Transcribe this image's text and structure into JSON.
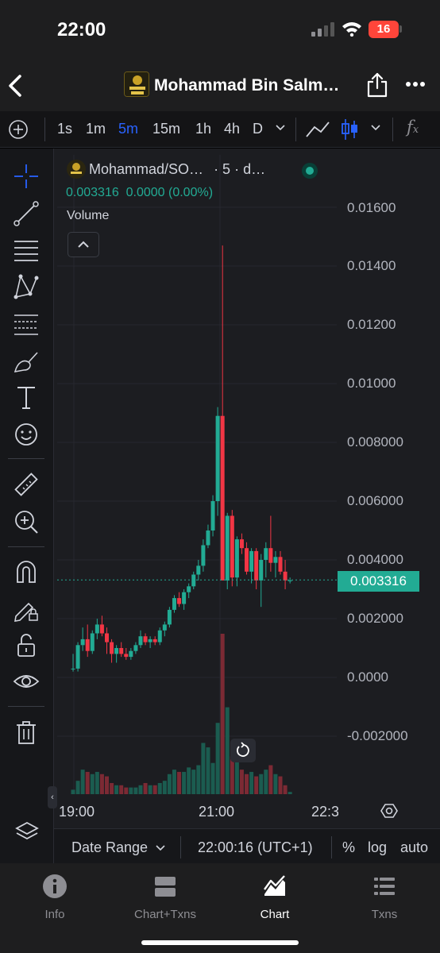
{
  "status_bar": {
    "time": "22:00",
    "battery": "16"
  },
  "header": {
    "title": "Mohammad Bin Salm…"
  },
  "timeframes": [
    "1s",
    "1m",
    "5m",
    "15m",
    "1h",
    "4h",
    "D"
  ],
  "active_timeframe": "5m",
  "legend": {
    "symbol": "Mohammad/SO…",
    "interval": "· 5 · d…",
    "price_line": "0.003316  0.0000 (0.00%)",
    "volume_label": "Volume"
  },
  "current_price_tag": "0.003316",
  "bottom_bar": {
    "date_range": "Date Range",
    "clock": "22:00:16 (UTC+1)",
    "percent": "%",
    "log": "log",
    "auto": "auto"
  },
  "tabs": [
    {
      "label": "Info",
      "icon": "info-icon"
    },
    {
      "label": "Chart+Txns",
      "icon": "split-view-icon"
    },
    {
      "label": "Chart",
      "icon": "chart-icon"
    },
    {
      "label": "Txns",
      "icon": "list-icon"
    }
  ],
  "active_tab": "Chart",
  "colors": {
    "up": "#22ab94",
    "down": "#f23645",
    "accent": "#2962ff",
    "background": "#1c1d21"
  },
  "chart_data": {
    "type": "candlestick",
    "y_axis": {
      "ticks": [
        "0.01600",
        "0.01400",
        "0.01200",
        "0.01000",
        "0.008000",
        "0.006000",
        "0.004000",
        "0.002000",
        "0.0000",
        "-0.002000"
      ],
      "range": [
        -0.0036,
        0.0177
      ]
    },
    "x_axis": {
      "ticks": [
        "19:00",
        "21:00",
        "22:3"
      ]
    },
    "current_price": 0.003316,
    "candles": [
      [
        0.0003,
        0.0008,
        0.0002,
        0.0003
      ],
      [
        0.0003,
        0.0012,
        0.0002,
        0.0011
      ],
      [
        0.0011,
        0.0017,
        0.0009,
        0.0013
      ],
      [
        0.0013,
        0.0018,
        0.0007,
        0.0009
      ],
      [
        0.0009,
        0.0016,
        0.0008,
        0.0015
      ],
      [
        0.0015,
        0.002,
        0.0013,
        0.0018
      ],
      [
        0.0018,
        0.0021,
        0.0014,
        0.0015
      ],
      [
        0.0015,
        0.0017,
        0.0008,
        0.0012
      ],
      [
        0.0012,
        0.0013,
        0.0005,
        0.0008
      ],
      [
        0.0008,
        0.0011,
        0.0005,
        0.001
      ],
      [
        0.001,
        0.0012,
        0.0007,
        0.0008
      ],
      [
        0.0008,
        0.001,
        0.0006,
        0.0007
      ],
      [
        0.0007,
        0.001,
        0.0006,
        0.0009
      ],
      [
        0.0009,
        0.0012,
        0.0008,
        0.0011
      ],
      [
        0.0011,
        0.0016,
        0.001,
        0.0014
      ],
      [
        0.0014,
        0.0015,
        0.0011,
        0.0012
      ],
      [
        0.0012,
        0.0014,
        0.001,
        0.0013
      ],
      [
        0.0013,
        0.0014,
        0.0011,
        0.0012
      ],
      [
        0.0012,
        0.0017,
        0.0011,
        0.0016
      ],
      [
        0.0016,
        0.0019,
        0.0014,
        0.0018
      ],
      [
        0.0018,
        0.0024,
        0.0017,
        0.0023
      ],
      [
        0.0023,
        0.0028,
        0.0022,
        0.0027
      ],
      [
        0.0027,
        0.0029,
        0.0024,
        0.0025
      ],
      [
        0.0025,
        0.003,
        0.0023,
        0.0029
      ],
      [
        0.0029,
        0.0032,
        0.0027,
        0.0031
      ],
      [
        0.0031,
        0.0036,
        0.003,
        0.0035
      ],
      [
        0.0035,
        0.004,
        0.0033,
        0.0038
      ],
      [
        0.0038,
        0.0047,
        0.0036,
        0.0045
      ],
      [
        0.0045,
        0.0052,
        0.0044,
        0.005
      ],
      [
        0.005,
        0.0062,
        0.0048,
        0.006
      ],
      [
        0.006,
        0.0092,
        0.0055,
        0.0089
      ],
      [
        0.0089,
        0.0147,
        0.0034,
        0.0033
      ],
      [
        0.0033,
        0.0056,
        0.003,
        0.0055
      ],
      [
        0.0055,
        0.0057,
        0.0031,
        0.0034
      ],
      [
        0.0034,
        0.0048,
        0.0031,
        0.0047
      ],
      [
        0.0047,
        0.0049,
        0.0042,
        0.0044
      ],
      [
        0.0044,
        0.0046,
        0.0035,
        0.0036
      ],
      [
        0.0036,
        0.0044,
        0.0032,
        0.0043
      ],
      [
        0.0043,
        0.0044,
        0.003,
        0.0033
      ],
      [
        0.0033,
        0.0042,
        0.0024,
        0.004
      ],
      [
        0.004,
        0.0046,
        0.0034,
        0.0044
      ],
      [
        0.0044,
        0.0055,
        0.0036,
        0.0039
      ],
      [
        0.0039,
        0.0043,
        0.0034,
        0.0041
      ],
      [
        0.0041,
        0.0043,
        0.0035,
        0.0036
      ],
      [
        0.0036,
        0.004,
        0.003,
        0.0033
      ],
      [
        0.0033,
        0.0034,
        0.0032,
        0.0033
      ]
    ],
    "volumes": [
      2,
      6,
      11,
      10,
      9,
      10,
      9,
      8,
      5,
      4,
      4,
      3,
      3,
      3,
      4,
      5,
      4,
      4,
      5,
      6,
      9,
      11,
      10,
      10,
      12,
      11,
      13,
      23,
      21,
      14,
      32,
      72,
      39,
      17,
      16,
      11,
      9,
      10,
      8,
      9,
      11,
      13,
      9,
      8,
      4,
      1
    ]
  }
}
